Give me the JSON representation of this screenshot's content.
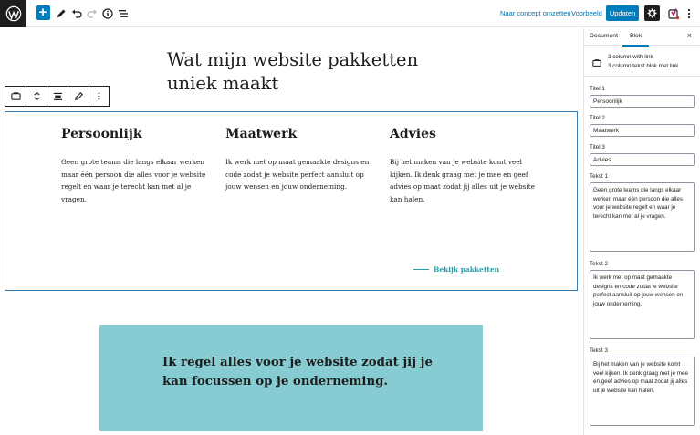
{
  "toolbar": {
    "logo_icon": "wordpress-logo",
    "draft_label": "Naar concept omzetten",
    "preview_label": "Voorbeeld",
    "update_label": "Updaten",
    "yoast_label": "y",
    "accent_color": "#007cba"
  },
  "editor": {
    "page_title": "Wat mijn website pakketten uniek maakt",
    "columns": [
      {
        "title": "Persoonlijk",
        "text": "Geen grote teams die langs elkaar werken maar één persoon die alles voor je website regelt en waar je terecht kan met al je vragen."
      },
      {
        "title": "Maatwerk",
        "text": "Ik werk met op maat gemaakte designs en code zodat je website perfect aansluit op jouw wensen en jouw onderneming."
      },
      {
        "title": "Advies",
        "text": "Bij het maken van je website komt veel kijken. Ik denk graag met je mee en geef advies op maat zodat jij alles uit je website kan halen."
      }
    ],
    "link_label": "Bekijk pakketten",
    "link_color": "#26a0a8",
    "cta_text": "Ik regel alles voor je website zodat jij je kan focussen op je onderneming.",
    "cta_color": "#87ccd2"
  },
  "sidebar": {
    "tab_document": "Document",
    "tab_block": "Blok",
    "close_label": "×",
    "block_name": "3 column with link",
    "block_desc": "3 column tekst blok met link",
    "fields": [
      {
        "label": "Titel 1",
        "value": "Persoonlijk"
      },
      {
        "label": "Titel 2",
        "value": "Maatwerk"
      },
      {
        "label": "Titel 3",
        "value": "Advies"
      },
      {
        "label": "Tekst 1",
        "value": "Geen grote teams die langs elkaar werken maar één persoon die alles voor je website regelt en waar je terecht kan met al je vragen."
      },
      {
        "label": "Tekst 2",
        "value": "Ik werk met op maat gemaakte designs en code zodat je website perfect aansluit op jouw wensen en jouw onderneming."
      },
      {
        "label": "Tekst 3",
        "value": "Bij het maken van je website komt veel kijken. Ik denk graag met je mee en geef advies op maat zodat jij alles uit je website kan halen."
      }
    ]
  }
}
